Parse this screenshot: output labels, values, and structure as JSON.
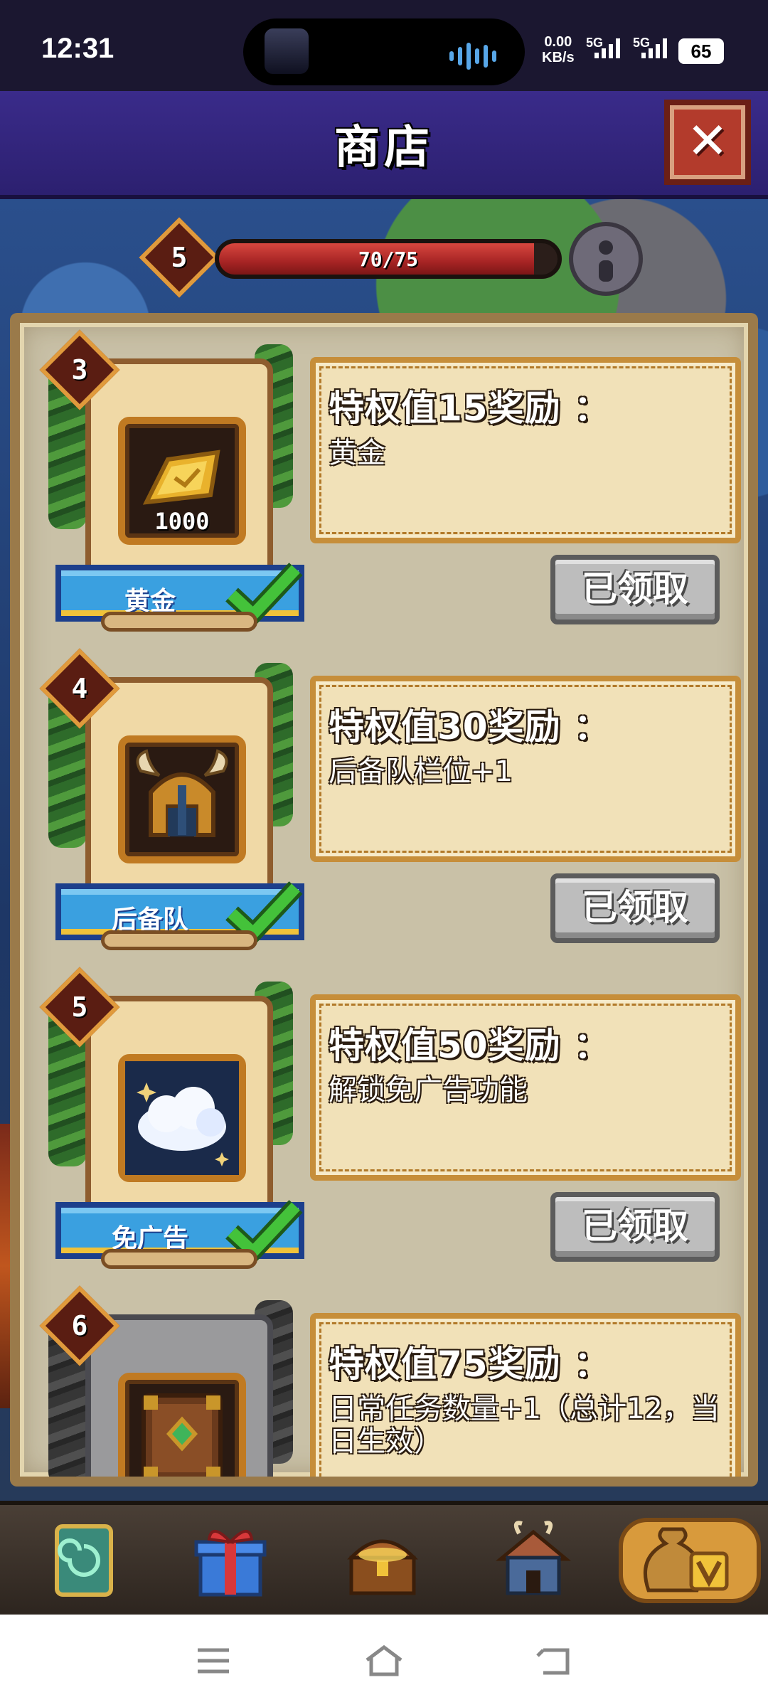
{
  "status": {
    "time": "12:31",
    "net_speed_value": "0.00",
    "net_speed_unit": "KB/s",
    "signal1": "5G",
    "signal2": "5G",
    "battery": "65"
  },
  "header": {
    "title": "商店"
  },
  "level": {
    "current": "5",
    "xp_text": "70/75",
    "progress": 0.93
  },
  "rewards": [
    {
      "level": "3",
      "title": "特权值15奖励 ：",
      "body": "黄金",
      "item_label": "黄金",
      "item_qty": "1000",
      "item_icon": "gold-bar-icon",
      "button": "已领取",
      "locked": false
    },
    {
      "level": "4",
      "title": "特权值30奖励 ：",
      "body": "后备队栏位+1",
      "item_label": "后备队",
      "item_qty": "",
      "item_icon": "helmet-icon",
      "button": "已领取",
      "locked": false
    },
    {
      "level": "5",
      "title": "特权值50奖励 ：",
      "body": "解锁免广告功能",
      "item_label": "免广告",
      "item_qty": "",
      "item_icon": "cloud-icon",
      "button": "已领取",
      "locked": false
    },
    {
      "level": "6",
      "title": "特权值75奖励 ：",
      "body": "日常任务数量+1（总计12，当日生效）",
      "item_label": "",
      "item_qty": "",
      "item_icon": "book-icon",
      "button": "",
      "locked": true
    }
  ],
  "tabs": [
    {
      "icon": "card-portal-icon"
    },
    {
      "icon": "gift-box-icon"
    },
    {
      "icon": "treasure-chest-icon"
    },
    {
      "icon": "house-icon"
    },
    {
      "icon": "money-bag-vip-icon"
    }
  ],
  "colors": {
    "accent_purple": "#3a2b8a",
    "claimed_gray": "#bdbdbd",
    "ribbon_blue": "#3aa0e0",
    "close_red": "#b33b2c"
  }
}
